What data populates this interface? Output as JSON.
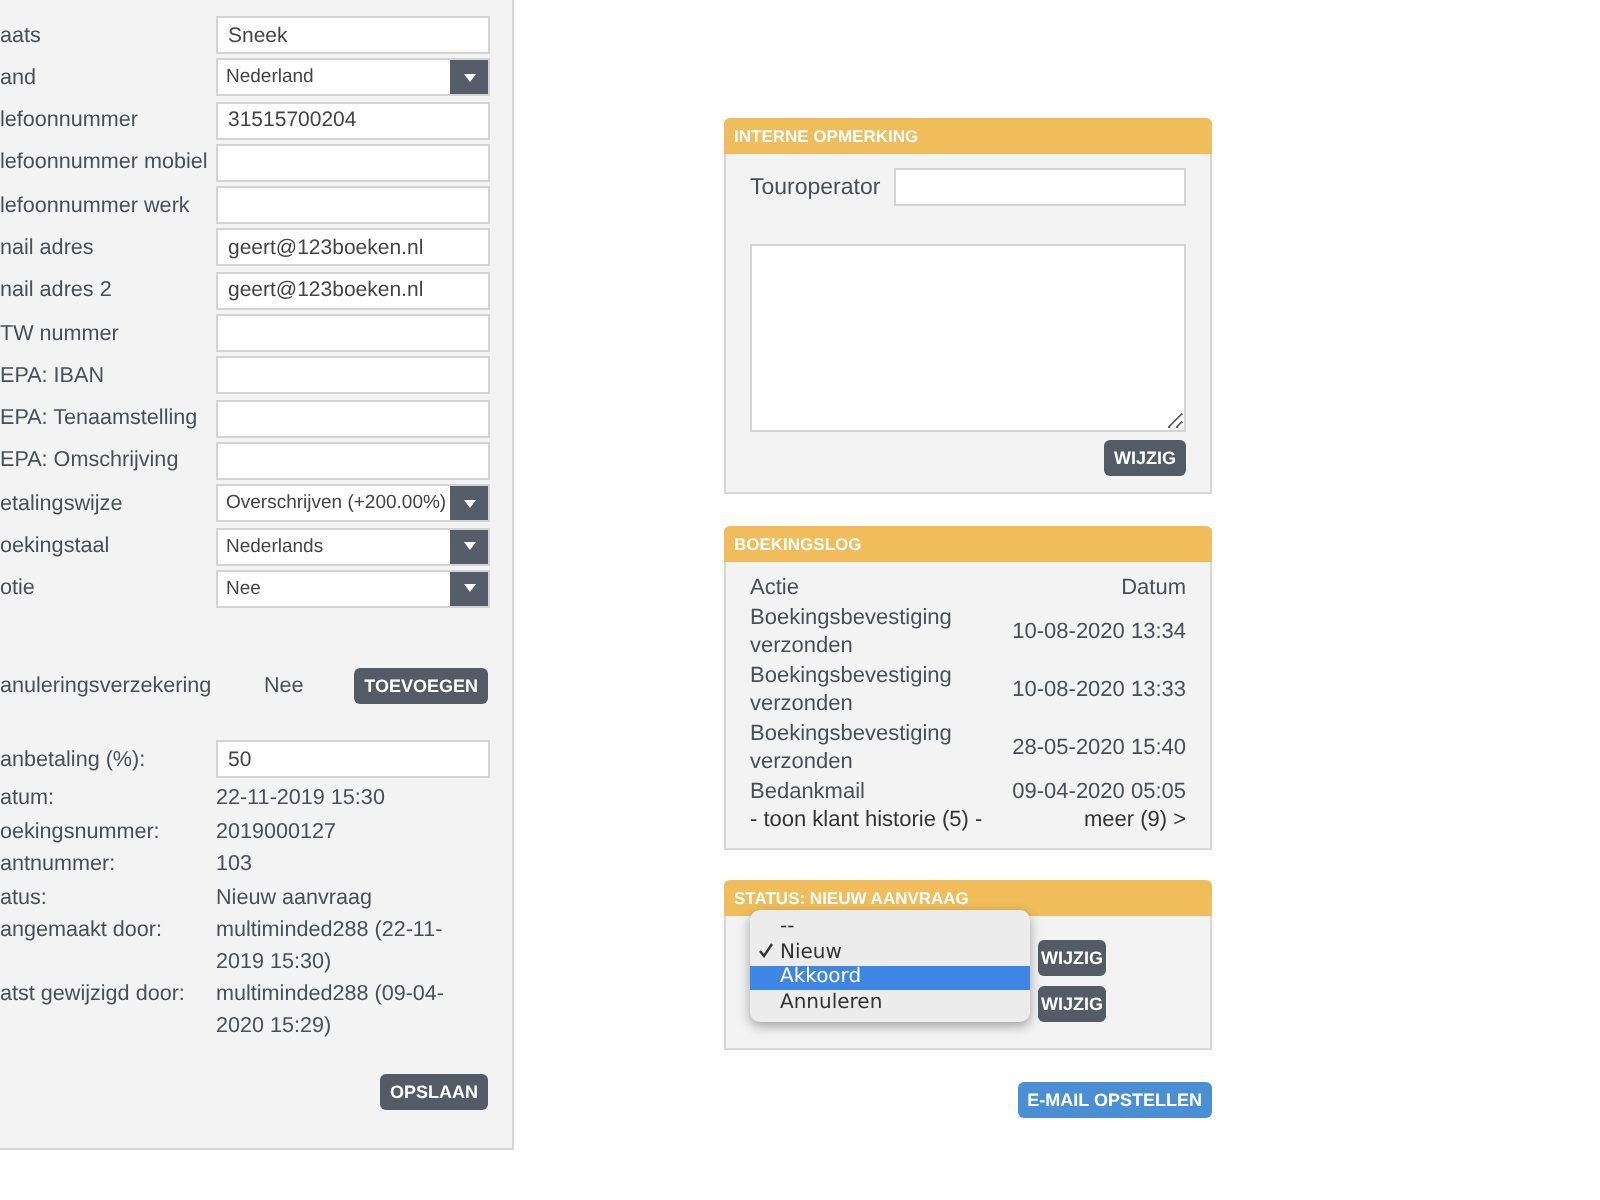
{
  "form_fields": [
    {
      "label": "aats",
      "kind": "text",
      "value": "Sneek"
    },
    {
      "label": "and",
      "kind": "select",
      "value": "Nederland"
    },
    {
      "label": "lefoonnummer",
      "kind": "text",
      "value": "31515700204"
    },
    {
      "label": "lefoonnummer mobiel",
      "kind": "text"
    },
    {
      "label": "lefoonnummer werk",
      "kind": "text"
    },
    {
      "label": "nail adres",
      "kind": "text",
      "value": "geert@123boeken.nl"
    },
    {
      "label": "nail adres 2",
      "kind": "text",
      "value": "geert@123boeken.nl"
    },
    {
      "label": "TW nummer",
      "kind": "text"
    },
    {
      "label": "EPA: IBAN",
      "kind": "text"
    },
    {
      "label": "EPA: Tenaamstelling",
      "kind": "text"
    },
    {
      "label": "EPA: Omschrijving",
      "kind": "text"
    },
    {
      "label": "etalingswijze",
      "kind": "select",
      "value": "Overschrijven (+200.00%)"
    },
    {
      "label": "oekingstaal",
      "kind": "select",
      "value": "Nederlands"
    },
    {
      "label": "otie",
      "kind": "select",
      "value": "Nee"
    }
  ],
  "insurance": {
    "label": "anuleringsverzekering",
    "value": "Nee",
    "button": "TOEVOEGEN"
  },
  "deposit": {
    "label": "anbetaling (%):",
    "value": "50"
  },
  "details": [
    {
      "label": "atum:",
      "value": "22-11-2019 15:30"
    },
    {
      "label": "oekingsnummer:",
      "value": "2019000127"
    },
    {
      "label": "antnummer:",
      "value": "103"
    },
    {
      "label": "atus:",
      "value": "Nieuw aanvraag"
    },
    {
      "label": "angemaakt door:",
      "value": "multiminded288 (22-11-2019 15:30)"
    },
    {
      "label": "atst gewijzigd door:",
      "value": "multiminded288 (09-04-2020 15:29)"
    }
  ],
  "save_button": "OPSLAAN",
  "internal_note": {
    "title": "INTERNE OPMERKING",
    "field_label": "Touroperator",
    "button": "WIJZIG"
  },
  "booking_log": {
    "title": "BOEKINGSLOG",
    "columns": [
      "Actie",
      "Datum"
    ],
    "rows": [
      {
        "action": "Boekingsbevestiging verzonden",
        "date": "10-08-2020 13:34"
      },
      {
        "action": "Boekingsbevestiging verzonden",
        "date": "10-08-2020 13:33"
      },
      {
        "action": "Boekingsbevestiging verzonden",
        "date": "28-05-2020 15:40"
      },
      {
        "action": "Bedankmail",
        "date": "09-04-2020 05:05"
      }
    ],
    "history_link": "- toon klant historie (5) -",
    "more_link": "meer (9) >"
  },
  "status": {
    "title": "STATUS: NIEUW AANVRAAG",
    "menu": [
      {
        "label": "--",
        "checked": false,
        "selected": false
      },
      {
        "label": "Nieuw",
        "checked": true,
        "selected": false
      },
      {
        "label": "Akkoord",
        "checked": false,
        "selected": true
      },
      {
        "label": "Annuleren",
        "checked": false,
        "selected": false
      }
    ],
    "buttons": [
      "WIJZIG",
      "WIJZIG"
    ]
  },
  "email_button": "E-MAIL OPSTELLEN"
}
